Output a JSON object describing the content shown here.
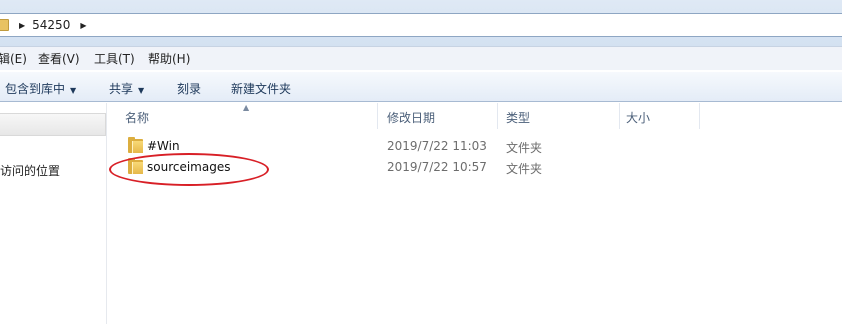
{
  "address_bar": {
    "crumb": "54250"
  },
  "menu": [
    "辑(E)",
    "查看(V)",
    "工具(T)",
    "帮助(H)"
  ],
  "commands": {
    "include_library": "包含到库中",
    "share": "共享",
    "burn": "刻录",
    "new_folder": "新建文件夹"
  },
  "nav": {
    "recent_places": "访问的位置"
  },
  "columns": {
    "name": "名称",
    "date": "修改日期",
    "type": "类型",
    "size": "大小"
  },
  "files": [
    {
      "name": "#Win",
      "date": "2019/7/22 11:03",
      "type": "文件夹"
    },
    {
      "name": "sourceimages",
      "date": "2019/7/22 10:57",
      "type": "文件夹"
    }
  ],
  "annotation_color": "#d81f26",
  "icons": [
    "folder-icon",
    "breadcrumb-arrow-icon",
    "dropdown-caret-icon",
    "sort-caret-icon"
  ]
}
